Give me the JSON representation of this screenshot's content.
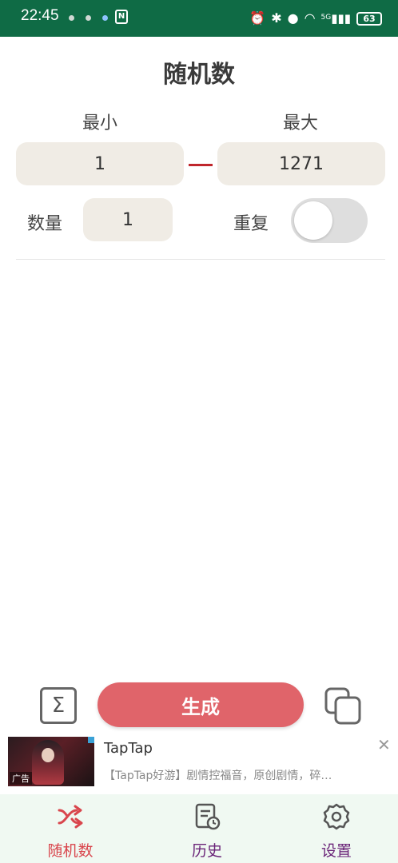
{
  "status_bar": {
    "time": "22:45",
    "signal_label": "5G",
    "battery": "63"
  },
  "page": {
    "title": "随机数"
  },
  "range": {
    "min_label": "最小",
    "max_label": "最大",
    "min_value": "1",
    "max_value": "1271"
  },
  "options": {
    "count_label": "数量",
    "count_value": "1",
    "repeat_label": "重复",
    "repeat_enabled": false
  },
  "actions": {
    "sum_icon": "sigma-icon",
    "generate_label": "生成",
    "copy_icon": "copy-icon"
  },
  "ad": {
    "thumb_tag": "广告",
    "title": "TapTap",
    "description": "【TapTap好游】剧情控福音，原创剧情，碎…",
    "close_symbol": "✕"
  },
  "nav": {
    "items": [
      {
        "label": "随机数",
        "icon": "shuffle-icon",
        "active": true
      },
      {
        "label": "历史",
        "icon": "history-icon",
        "active": false
      },
      {
        "label": "设置",
        "icon": "gear-icon",
        "active": false
      }
    ]
  },
  "colors": {
    "status_bar": "#0f6b45",
    "accent": "#e0646a",
    "active_nav": "#d9464d",
    "inactive_nav": "#6a2478",
    "range_dash": "#c0262c",
    "field_bg": "#f0ece5"
  }
}
